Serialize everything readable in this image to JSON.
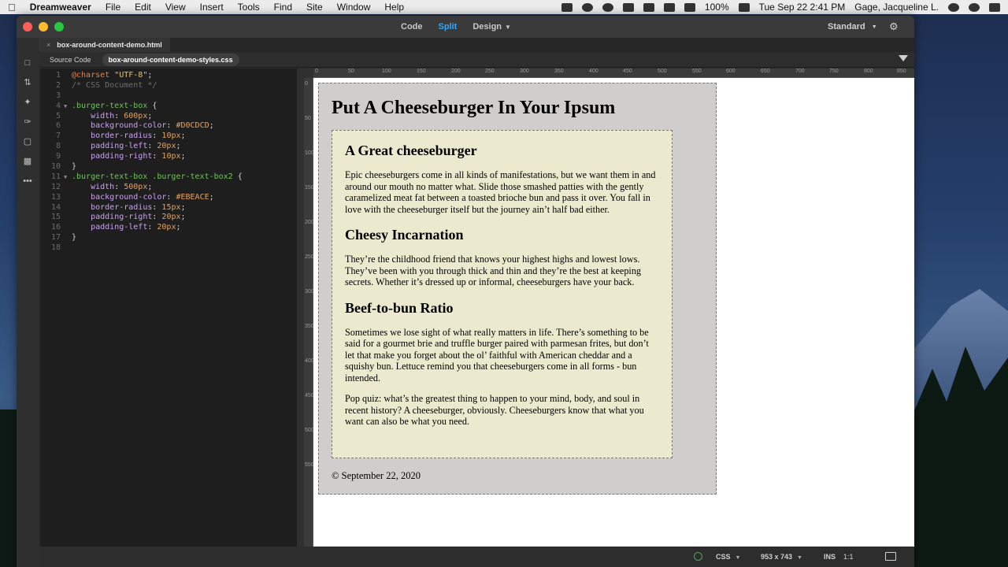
{
  "menubar": {
    "app_name": "Dreamweaver",
    "items": [
      "File",
      "Edit",
      "View",
      "Insert",
      "Tools",
      "Find",
      "Site",
      "Window",
      "Help"
    ],
    "battery": "100%",
    "datetime": "Tue Sep 22  2:41 PM",
    "user": "Gage, Jacqueline L."
  },
  "toolbar": {
    "views": {
      "code": "Code",
      "split": "Split",
      "design": "Design"
    },
    "workspace": "Standard"
  },
  "tabs": {
    "open_file": "box-around-content-demo.html",
    "source_code": "Source Code",
    "related_css": "box-around-content-demo-styles.css"
  },
  "code": {
    "line_numbers": [
      "1",
      "2",
      "3",
      "4",
      "5",
      "6",
      "7",
      "8",
      "9",
      "10",
      "11",
      "12",
      "13",
      "14",
      "15",
      "16",
      "17",
      "18"
    ]
  },
  "rulers": {
    "top": [
      "0",
      "50",
      "100",
      "150",
      "200",
      "250",
      "300",
      "350",
      "400",
      "450",
      "500",
      "550",
      "600",
      "650",
      "700",
      "750",
      "800",
      "850",
      "900"
    ],
    "left": [
      "0",
      "50",
      "100",
      "150",
      "200",
      "250",
      "300",
      "350",
      "400",
      "450",
      "500",
      "550"
    ]
  },
  "page": {
    "title": "Put A Cheeseburger In Your Ipsum",
    "sections": [
      {
        "heading": "A Great cheeseburger",
        "body": "Epic cheeseburgers come in all kinds of manifestations, but we want them in and around our mouth no matter what. Slide those smashed patties with the gently caramelized meat fat between a toasted brioche bun and pass it over. You fall in love with the cheeseburger itself but the journey ain’t half bad either."
      },
      {
        "heading": "Cheesy Incarnation",
        "body": "They’re the childhood friend that knows your highest highs and lowest lows. They’ve been with you through thick and thin and they’re the best at keeping secrets. Whether it’s dressed up or informal, cheeseburgers have your back."
      },
      {
        "heading": "Beef-to-bun Ratio",
        "body": "Sometimes we lose sight of what really matters in life. There’s something to be said for a gourmet brie and truffle burger paired with parmesan frites, but don’t let that make you forget about the ol’ faithful with American cheddar and a squishy bun. Lettuce remind you that cheeseburgers come in all forms - bun intended.",
        "body2": "Pop quiz: what’s the greatest thing to happen to your mind, body, and soul in recent history? A cheeseburger, obviously. Cheeseburgers know that what you want can also be what you need."
      }
    ],
    "footer": "© September 22, 2020"
  },
  "statusbar": {
    "language": "CSS",
    "dimensions": "953 x 743",
    "mode": "INS",
    "position": "1:1"
  }
}
